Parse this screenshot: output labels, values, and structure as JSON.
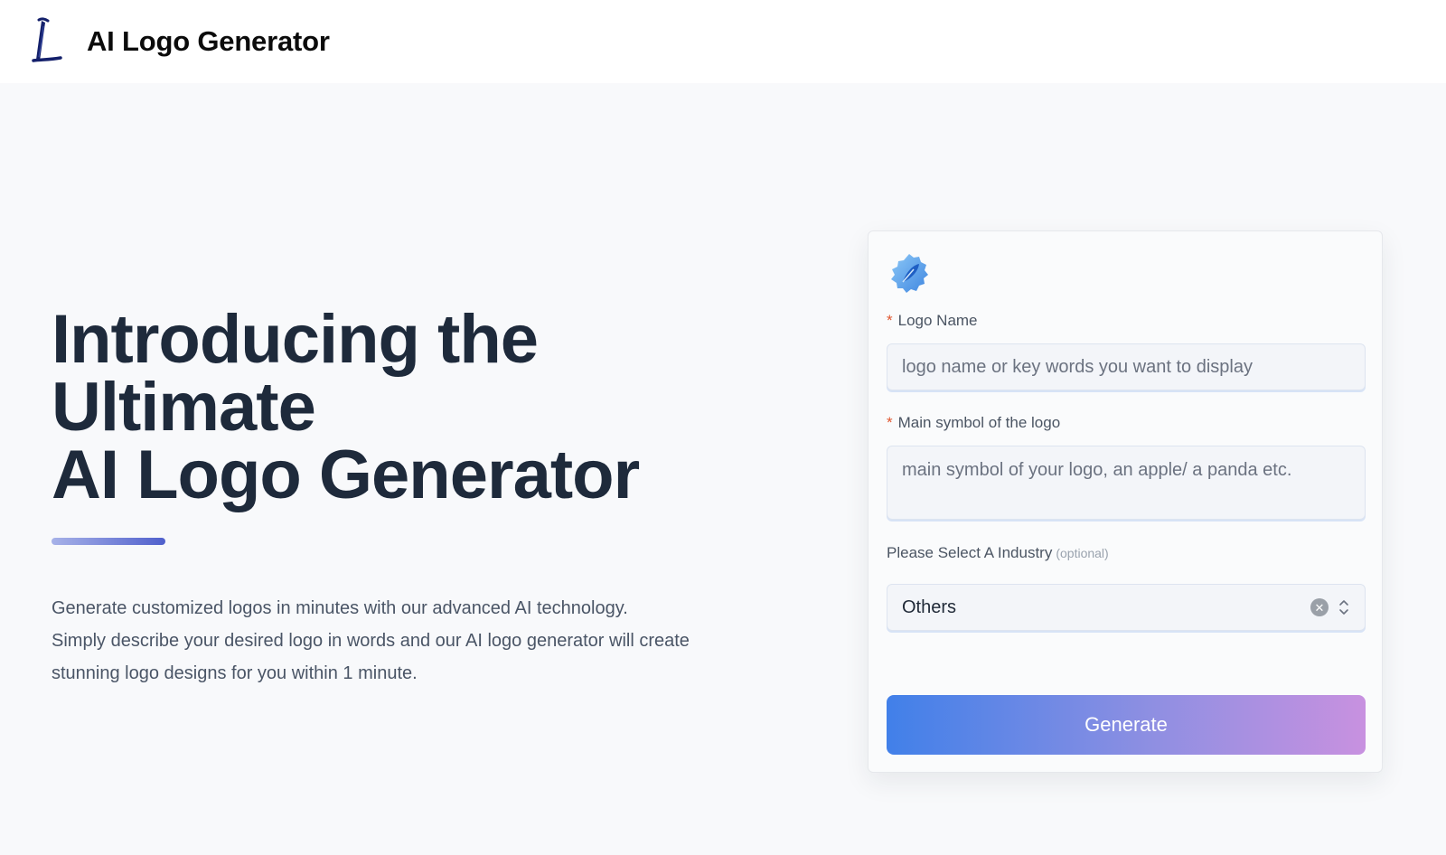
{
  "header": {
    "title": "AI Logo Generator",
    "logo_icon": "brush-letter-l-logo"
  },
  "hero": {
    "title_lines": [
      "Introducing the",
      "Ultimate",
      "AI Logo Generator"
    ],
    "description_lines": [
      "Generate customized logos in minutes with our advanced AI technology.",
      "Simply describe your desired logo in words and our AI logo generator will create",
      "stunning logo designs for you within 1 minute."
    ]
  },
  "form": {
    "card_icon": "badge-feather-icon",
    "logo_name": {
      "required_mark": "*",
      "label": "Logo Name",
      "placeholder": "logo name or key words you want to display",
      "value": ""
    },
    "main_symbol": {
      "required_mark": "*",
      "label": "Main symbol of the logo",
      "placeholder": "main symbol of your logo, an apple/ a panda etc.",
      "value": ""
    },
    "industry": {
      "label": "Please Select A Industry",
      "optional_label": "(optional)",
      "selected": "Others"
    },
    "generate_label": "Generate"
  },
  "colors": {
    "title": "#1e2a3b",
    "required": "#e0562f",
    "button_gradient_start": "#4180e9",
    "button_gradient_end": "#c891e0"
  }
}
